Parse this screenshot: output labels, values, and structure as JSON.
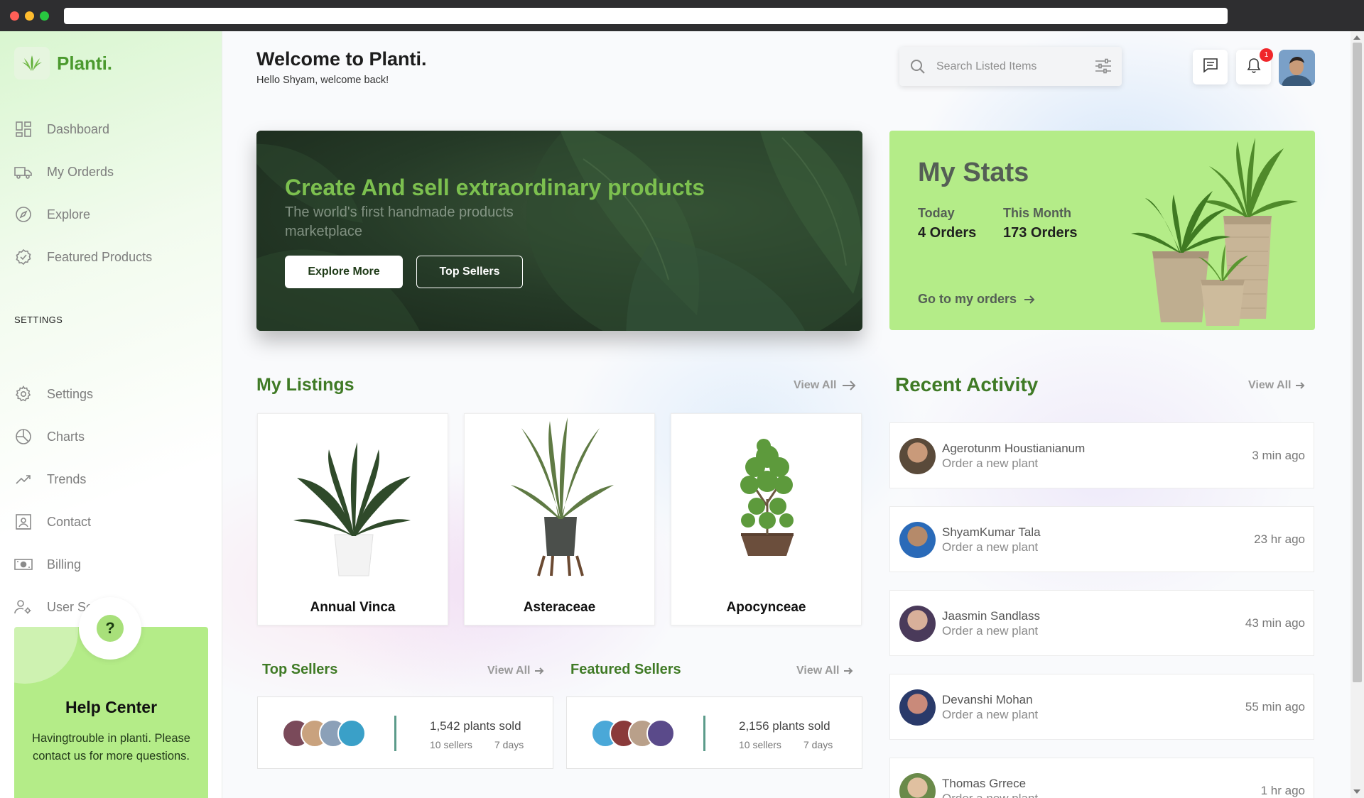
{
  "brand": {
    "name": "Planti.",
    "color": "#4b9a2e",
    "accent": "#b4ec88"
  },
  "sidebar": {
    "items": [
      {
        "label": "Dashboard",
        "icon": "grid-icon"
      },
      {
        "label": "My Orderds",
        "icon": "truck-icon"
      },
      {
        "label": "Explore",
        "icon": "compass-icon"
      },
      {
        "label": "Featured Products",
        "icon": "badge-check-icon"
      }
    ],
    "settings_heading": "SETTINGS",
    "settings_items": [
      {
        "label": "Settings",
        "icon": "gear-icon"
      },
      {
        "label": "Charts",
        "icon": "pie-chart-icon"
      },
      {
        "label": "Trends",
        "icon": "trending-up-icon"
      },
      {
        "label": "Contact",
        "icon": "contact-card-icon"
      },
      {
        "label": "Billing",
        "icon": "money-icon"
      },
      {
        "label": "User Settings",
        "icon": "user-gear-icon"
      }
    ],
    "help": {
      "icon_text": "?",
      "title": "Help Center",
      "text": "Havingtrouble in planti. Please contact us for more questions."
    }
  },
  "header": {
    "title": "Welcome to Planti.",
    "subtitle": "Hello Shyam, welcome back!",
    "search_placeholder": "Search Listed Items",
    "notification_count": "1"
  },
  "hero": {
    "title": "Create And sell extraordinary products",
    "subtitle": "The world's first handmade products marketplace",
    "primary_button": "Explore More",
    "secondary_button": "Top Sellers"
  },
  "stats": {
    "title": "My Stats",
    "today_label": "Today",
    "today_value": "4 Orders",
    "month_label": "This Month",
    "month_value": "173 Orders",
    "link": "Go to my orders"
  },
  "listings": {
    "title": "My Listings",
    "view_all": "View All",
    "items": [
      {
        "name": "Annual Vinca"
      },
      {
        "name": "Asteraceae"
      },
      {
        "name": "Apocynceae"
      }
    ]
  },
  "top_sellers": {
    "title": "Top Sellers",
    "view_all": "View All",
    "sold": "1,542 plants sold",
    "sellers": "10 sellers",
    "period": "7 days"
  },
  "featured_sellers": {
    "title": "Featured Sellers",
    "view_all": "View All",
    "sold": "2,156 plants sold",
    "sellers": "10 sellers",
    "period": "7 days"
  },
  "activity": {
    "title": "Recent Activity",
    "view_all": "View All",
    "items": [
      {
        "name": "Agerotunm Houstianianum",
        "action": "Order a new plant",
        "time": "3 min ago"
      },
      {
        "name": "ShyamKumar Tala",
        "action": "Order a new plant",
        "time": "23 hr ago"
      },
      {
        "name": "Jaasmin Sandlass",
        "action": "Order a new plant",
        "time": "43 min ago"
      },
      {
        "name": "Devanshi Mohan",
        "action": "Order a new plant",
        "time": "55 min ago"
      },
      {
        "name": "Thomas Grrece",
        "action": "Order a new plant",
        "time": "1 hr ago"
      }
    ]
  }
}
